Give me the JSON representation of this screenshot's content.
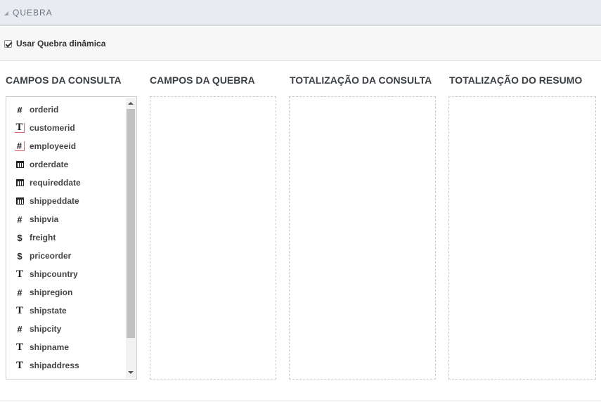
{
  "section": {
    "title": "QUEBRA",
    "collapse_icon": "triangle-collapse-icon"
  },
  "option": {
    "label": "Usar Quebra dinâmica",
    "checked": true
  },
  "columns": {
    "campos_consulta": "CAMPOS DA CONSULTA",
    "campos_quebra": "CAMPOS DA QUEBRA",
    "totalizacao_consulta": "TOTALIZAÇÃO DA CONSULTA",
    "totalizacao_resumo": "TOTALIZAÇÃO DO RESUMO"
  },
  "fields": [
    {
      "label": "orderid",
      "icon": "number-icon",
      "glyph": "#"
    },
    {
      "label": "customerid",
      "icon": "text-key-icon",
      "glyph": "T"
    },
    {
      "label": "employeeid",
      "icon": "number-key-icon",
      "glyph": "#"
    },
    {
      "label": "orderdate",
      "icon": "calendar-icon",
      "glyph": ""
    },
    {
      "label": "requireddate",
      "icon": "calendar-icon",
      "glyph": ""
    },
    {
      "label": "shippeddate",
      "icon": "calendar-icon",
      "glyph": ""
    },
    {
      "label": "shipvia",
      "icon": "number-icon",
      "glyph": "#"
    },
    {
      "label": "freight",
      "icon": "currency-icon",
      "glyph": "$"
    },
    {
      "label": "priceorder",
      "icon": "currency-icon",
      "glyph": "$"
    },
    {
      "label": "shipcountry",
      "icon": "text-icon",
      "glyph": "T"
    },
    {
      "label": "shipregion",
      "icon": "number-icon",
      "glyph": "#"
    },
    {
      "label": "shipstate",
      "icon": "text-icon",
      "glyph": "T"
    },
    {
      "label": "shipcity",
      "icon": "number-icon",
      "glyph": "#"
    },
    {
      "label": "shipname",
      "icon": "text-icon",
      "glyph": "T"
    },
    {
      "label": "shipaddress",
      "icon": "text-icon",
      "glyph": "T"
    }
  ],
  "colors": {
    "header_bg": "#e8ebf0",
    "dashed_border": "#c8c8d8"
  }
}
